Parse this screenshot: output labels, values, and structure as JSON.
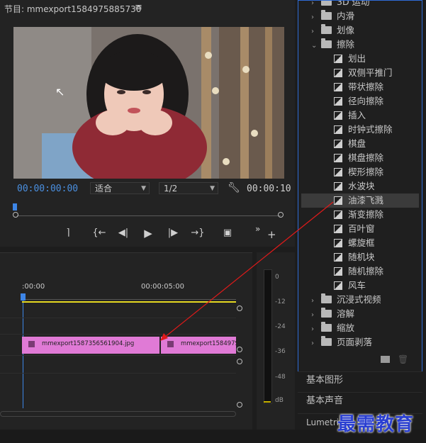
{
  "program": {
    "title": "节目: mmexport1584975885730",
    "menu_icon": "hamburger-icon",
    "timecode_current": "00:00:00:00",
    "fit_dropdown": "适合",
    "resolution_dropdown": "1/2",
    "timecode_duration": "00:00:10",
    "controls": [
      "mark-in-icon",
      "go-to-in-icon",
      "step-back-icon",
      "play-icon",
      "step-forward-icon",
      "go-to-out-icon",
      "export-frame-icon"
    ]
  },
  "effects": {
    "top_items": [
      {
        "label": "3D 运动"
      },
      {
        "label": "内滑"
      },
      {
        "label": "划像"
      },
      {
        "label": "擦除"
      }
    ],
    "wipe_items": [
      "划出",
      "双侧平推门",
      "带状擦除",
      "径向擦除",
      "插入",
      "时钟式擦除",
      "棋盘",
      "棋盘擦除",
      "楔形擦除",
      "水波块",
      "油漆飞溅",
      "渐变擦除",
      "百叶窗",
      "螺旋框",
      "随机块",
      "随机擦除",
      "风车"
    ],
    "selected_item": "油漆飞溅",
    "bottom_items": [
      "沉浸式视频",
      "溶解",
      "缩放",
      "页面剥落"
    ]
  },
  "panels": {
    "essential_graphics": "基本图形",
    "essential_sound": "基本声音",
    "lumetri": "Lumetri"
  },
  "timeline": {
    "ruler_start": ":00:00",
    "ruler_mid": "00:00:05:00",
    "clip_a": "mmexport1587356561904.jpg",
    "clip_b": "mmexport158497S"
  },
  "meter": {
    "labels": [
      "0",
      "-12",
      "-24",
      "-36",
      "-48",
      "dB"
    ]
  },
  "watermark": "最需教育",
  "colors": {
    "accent_blue": "#2e6bd6",
    "clip_pink": "#e07ad6",
    "annotation_red": "#e01a1a",
    "timecode_blue": "#4a8fe0"
  }
}
